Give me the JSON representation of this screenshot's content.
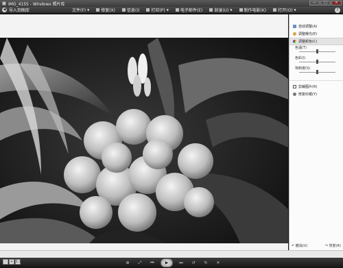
{
  "window": {
    "title": "IMG_4155 - Windows 照片库",
    "controls": [
      "minimize",
      "maximize",
      "close"
    ]
  },
  "toolbar": {
    "back_label": "导入到图库",
    "menus": [
      {
        "label": "文件(F)",
        "has_menu": true
      },
      {
        "label": "修复(X)",
        "has_menu": false
      },
      {
        "label": "信息(I)",
        "has_menu": false
      },
      {
        "label": "打印(P)",
        "has_menu": true
      },
      {
        "label": "电子邮件(E)",
        "has_menu": false
      },
      {
        "label": "刻录(U)",
        "has_menu": true
      },
      {
        "label": "制作电影(K)",
        "has_menu": false
      },
      {
        "label": "打开(O)",
        "has_menu": true
      }
    ],
    "help_label": "?"
  },
  "panel": {
    "items_top": [
      {
        "label": "自动调整(A)",
        "icon": "wand-icon"
      },
      {
        "label": "调整曝光(E)",
        "icon": "sun-icon"
      }
    ],
    "color_group": {
      "label": "调整颜色(C)",
      "sliders": [
        {
          "label": "色温(T)",
          "value": 0.5
        },
        {
          "label": "色彩(I)",
          "value": 0.5
        },
        {
          "label": "饱和度(S)",
          "value": 0.5
        }
      ]
    },
    "items_bottom": [
      {
        "label": "剪裁图片(R)",
        "icon": "crop-icon"
      },
      {
        "label": "修复红眼(Y)",
        "icon": "eye-icon"
      }
    ],
    "undo_label": "撤消(U)",
    "redo_label": "恢复(R)"
  },
  "bottom": {
    "zoom_buttons": [
      "-",
      "+",
      "1:1"
    ],
    "slideshow_label": "▶"
  },
  "colors": {
    "titlebar": "#3a3a3a",
    "panel_bg": "#fbfbfb",
    "viewer_bg": "#f3f3f3"
  }
}
